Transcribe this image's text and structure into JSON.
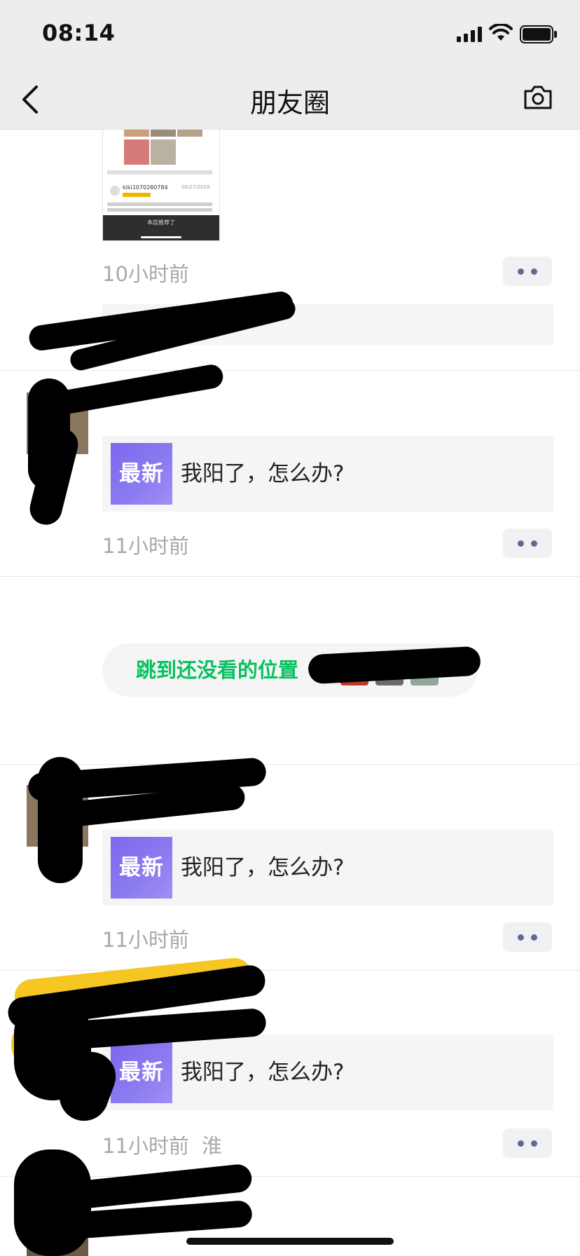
{
  "status_bar": {
    "time": "08:14"
  },
  "nav": {
    "title": "朋友圈"
  },
  "post0": {
    "shot_user": "kiki1070280784",
    "shot_date": "06/27/2019",
    "shot_tab": "本店推荐了",
    "time": "10小时前"
  },
  "posts": [
    {
      "shared_badge": "最新",
      "shared_text": "我阳了，怎么办?",
      "time": "11小时前"
    },
    {
      "shared_badge": "最新",
      "shared_text": "我阳了，怎么办?",
      "time": "11小时前"
    },
    {
      "shared_badge": "最新",
      "shared_text": "我阳了，怎么办?",
      "time": "11小时前",
      "location": "淮"
    }
  ],
  "jump": {
    "label": "跳到还没看的位置"
  },
  "colors": {
    "accent": "#07c160",
    "link": "#576b95",
    "badge": "#8c7cf0"
  }
}
